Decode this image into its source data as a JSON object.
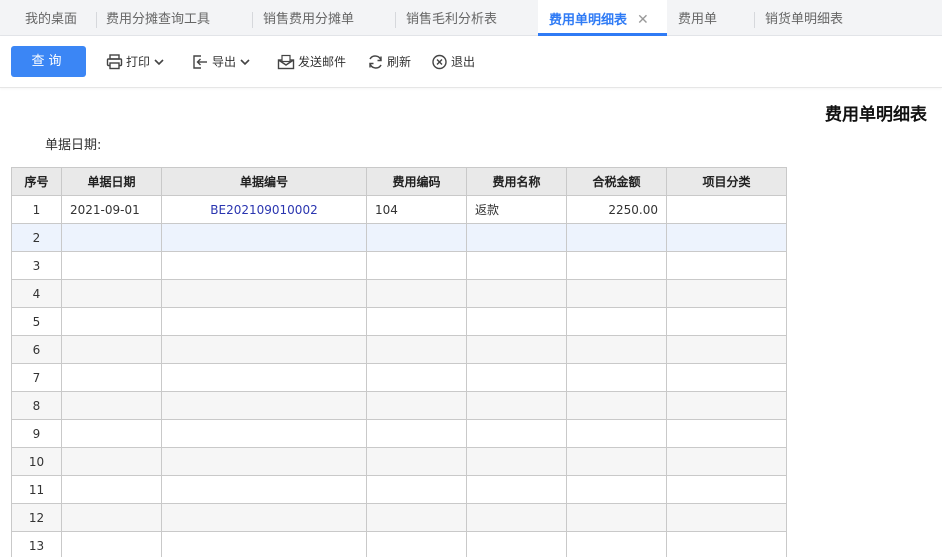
{
  "tabs": [
    {
      "label": "我的桌面"
    },
    {
      "label": "费用分摊查询工具"
    },
    {
      "label": "销售费用分摊单"
    },
    {
      "label": "销售毛利分析表"
    },
    {
      "label": "费用单明细表",
      "active": true,
      "close": "✕"
    },
    {
      "label": "费用单"
    },
    {
      "label": "销货单明细表"
    }
  ],
  "toolbar": {
    "query": "查询",
    "print": "打印",
    "export": "导出",
    "email": "发送邮件",
    "refresh": "刷新",
    "exit": "退出"
  },
  "report": {
    "title": "费用单明细表",
    "date_label": "单据日期:"
  },
  "table": {
    "headers": [
      "序号",
      "单据日期",
      "单据编号",
      "费用编码",
      "费用名称",
      "合税金额",
      "项目分类"
    ],
    "rows": [
      {
        "no": "1",
        "date": "2021-09-01",
        "doc": "BE202109010002",
        "code": "104",
        "name": "返款",
        "amount": "2250.00",
        "cat": ""
      },
      {
        "no": "2",
        "date": "",
        "doc": "",
        "code": "",
        "name": "",
        "amount": "",
        "cat": ""
      },
      {
        "no": "3",
        "date": "",
        "doc": "",
        "code": "",
        "name": "",
        "amount": "",
        "cat": ""
      },
      {
        "no": "4",
        "date": "",
        "doc": "",
        "code": "",
        "name": "",
        "amount": "",
        "cat": ""
      },
      {
        "no": "5",
        "date": "",
        "doc": "",
        "code": "",
        "name": "",
        "amount": "",
        "cat": ""
      },
      {
        "no": "6",
        "date": "",
        "doc": "",
        "code": "",
        "name": "",
        "amount": "",
        "cat": ""
      },
      {
        "no": "7",
        "date": "",
        "doc": "",
        "code": "",
        "name": "",
        "amount": "",
        "cat": ""
      },
      {
        "no": "8",
        "date": "",
        "doc": "",
        "code": "",
        "name": "",
        "amount": "",
        "cat": ""
      },
      {
        "no": "9",
        "date": "",
        "doc": "",
        "code": "",
        "name": "",
        "amount": "",
        "cat": ""
      },
      {
        "no": "10",
        "date": "",
        "doc": "",
        "code": "",
        "name": "",
        "amount": "",
        "cat": ""
      },
      {
        "no": "11",
        "date": "",
        "doc": "",
        "code": "",
        "name": "",
        "amount": "",
        "cat": ""
      },
      {
        "no": "12",
        "date": "",
        "doc": "",
        "code": "",
        "name": "",
        "amount": "",
        "cat": ""
      },
      {
        "no": "13",
        "date": "",
        "doc": "",
        "code": "",
        "name": "",
        "amount": "",
        "cat": ""
      }
    ]
  },
  "colors": {
    "accent": "#3b86f5",
    "link": "#2a35b0",
    "selected_row": "#edf3fd"
  }
}
